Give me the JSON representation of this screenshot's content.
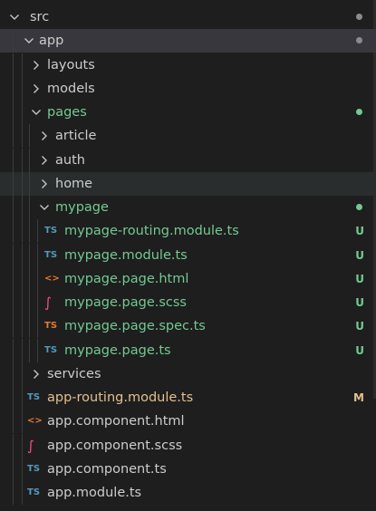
{
  "colors": {
    "folder_text": "#cccccc",
    "git_untracked": "#73c991",
    "git_modified": "#e2c08d",
    "git_dot_neutral": "#8b8b8b",
    "ts_icon": "#519aba",
    "ts_spec_icon": "#e37933",
    "html_icon": "#e37933",
    "scss_icon": "#f55385"
  },
  "rows": [
    {
      "name": "src",
      "kind": "folder",
      "open": true,
      "depth": 0,
      "color": "#cccccc",
      "dot": "#8b8b8b"
    },
    {
      "name": "app",
      "kind": "folder",
      "open": true,
      "depth": 1,
      "color": "#cccccc",
      "dot": "#8b8b8b",
      "active": true
    },
    {
      "name": "layouts",
      "kind": "folder",
      "open": false,
      "depth": 2,
      "color": "#cccccc"
    },
    {
      "name": "models",
      "kind": "folder",
      "open": false,
      "depth": 2,
      "color": "#cccccc"
    },
    {
      "name": "pages",
      "kind": "folder",
      "open": true,
      "depth": 2,
      "color": "#73c991",
      "dot": "#73c991"
    },
    {
      "name": "article",
      "kind": "folder",
      "open": false,
      "depth": 3,
      "color": "#cccccc"
    },
    {
      "name": "auth",
      "kind": "folder",
      "open": false,
      "depth": 3,
      "color": "#cccccc"
    },
    {
      "name": "home",
      "kind": "folder",
      "open": false,
      "depth": 3,
      "color": "#cccccc",
      "hover": true
    },
    {
      "name": "mypage",
      "kind": "folder",
      "open": true,
      "depth": 3,
      "color": "#73c991",
      "dot": "#73c991"
    },
    {
      "name": "mypage-routing.module.ts",
      "kind": "file",
      "icon": "typescript-icon",
      "glyph": "TS",
      "iconColor": "#519aba",
      "depth": 4,
      "color": "#73c991",
      "badge": "U"
    },
    {
      "name": "mypage.module.ts",
      "kind": "file",
      "icon": "typescript-icon",
      "glyph": "TS",
      "iconColor": "#519aba",
      "depth": 4,
      "color": "#73c991",
      "badge": "U"
    },
    {
      "name": "mypage.page.html",
      "kind": "file",
      "icon": "html-icon",
      "glyph": "<>",
      "iconColor": "#e37933",
      "depth": 4,
      "color": "#73c991",
      "badge": "U"
    },
    {
      "name": "mypage.page.scss",
      "kind": "file",
      "icon": "sass-icon",
      "glyph": "∫",
      "iconColor": "#f55385",
      "depth": 4,
      "color": "#73c991",
      "badge": "U"
    },
    {
      "name": "mypage.page.spec.ts",
      "kind": "file",
      "icon": "typescript-spec-icon",
      "glyph": "TS",
      "iconColor": "#e37933",
      "depth": 4,
      "color": "#73c991",
      "badge": "U"
    },
    {
      "name": "mypage.page.ts",
      "kind": "file",
      "icon": "typescript-icon",
      "glyph": "TS",
      "iconColor": "#519aba",
      "depth": 4,
      "color": "#73c991",
      "badge": "U"
    },
    {
      "name": "services",
      "kind": "folder",
      "open": false,
      "depth": 2,
      "color": "#cccccc"
    },
    {
      "name": "app-routing.module.ts",
      "kind": "file",
      "icon": "typescript-icon",
      "glyph": "TS",
      "iconColor": "#519aba",
      "depth": 2,
      "color": "#e2c08d",
      "badge": "M",
      "badgeColor": "#e2c08d"
    },
    {
      "name": "app.component.html",
      "kind": "file",
      "icon": "html-icon",
      "glyph": "<>",
      "iconColor": "#e37933",
      "depth": 2,
      "color": "#cccccc"
    },
    {
      "name": "app.component.scss",
      "kind": "file",
      "icon": "sass-icon",
      "glyph": "∫",
      "iconColor": "#f55385",
      "depth": 2,
      "color": "#cccccc"
    },
    {
      "name": "app.component.ts",
      "kind": "file",
      "icon": "typescript-icon",
      "glyph": "TS",
      "iconColor": "#519aba",
      "depth": 2,
      "color": "#cccccc"
    },
    {
      "name": "app.module.ts",
      "kind": "file",
      "icon": "typescript-icon",
      "glyph": "TS",
      "iconColor": "#519aba",
      "depth": 2,
      "color": "#cccccc"
    }
  ]
}
